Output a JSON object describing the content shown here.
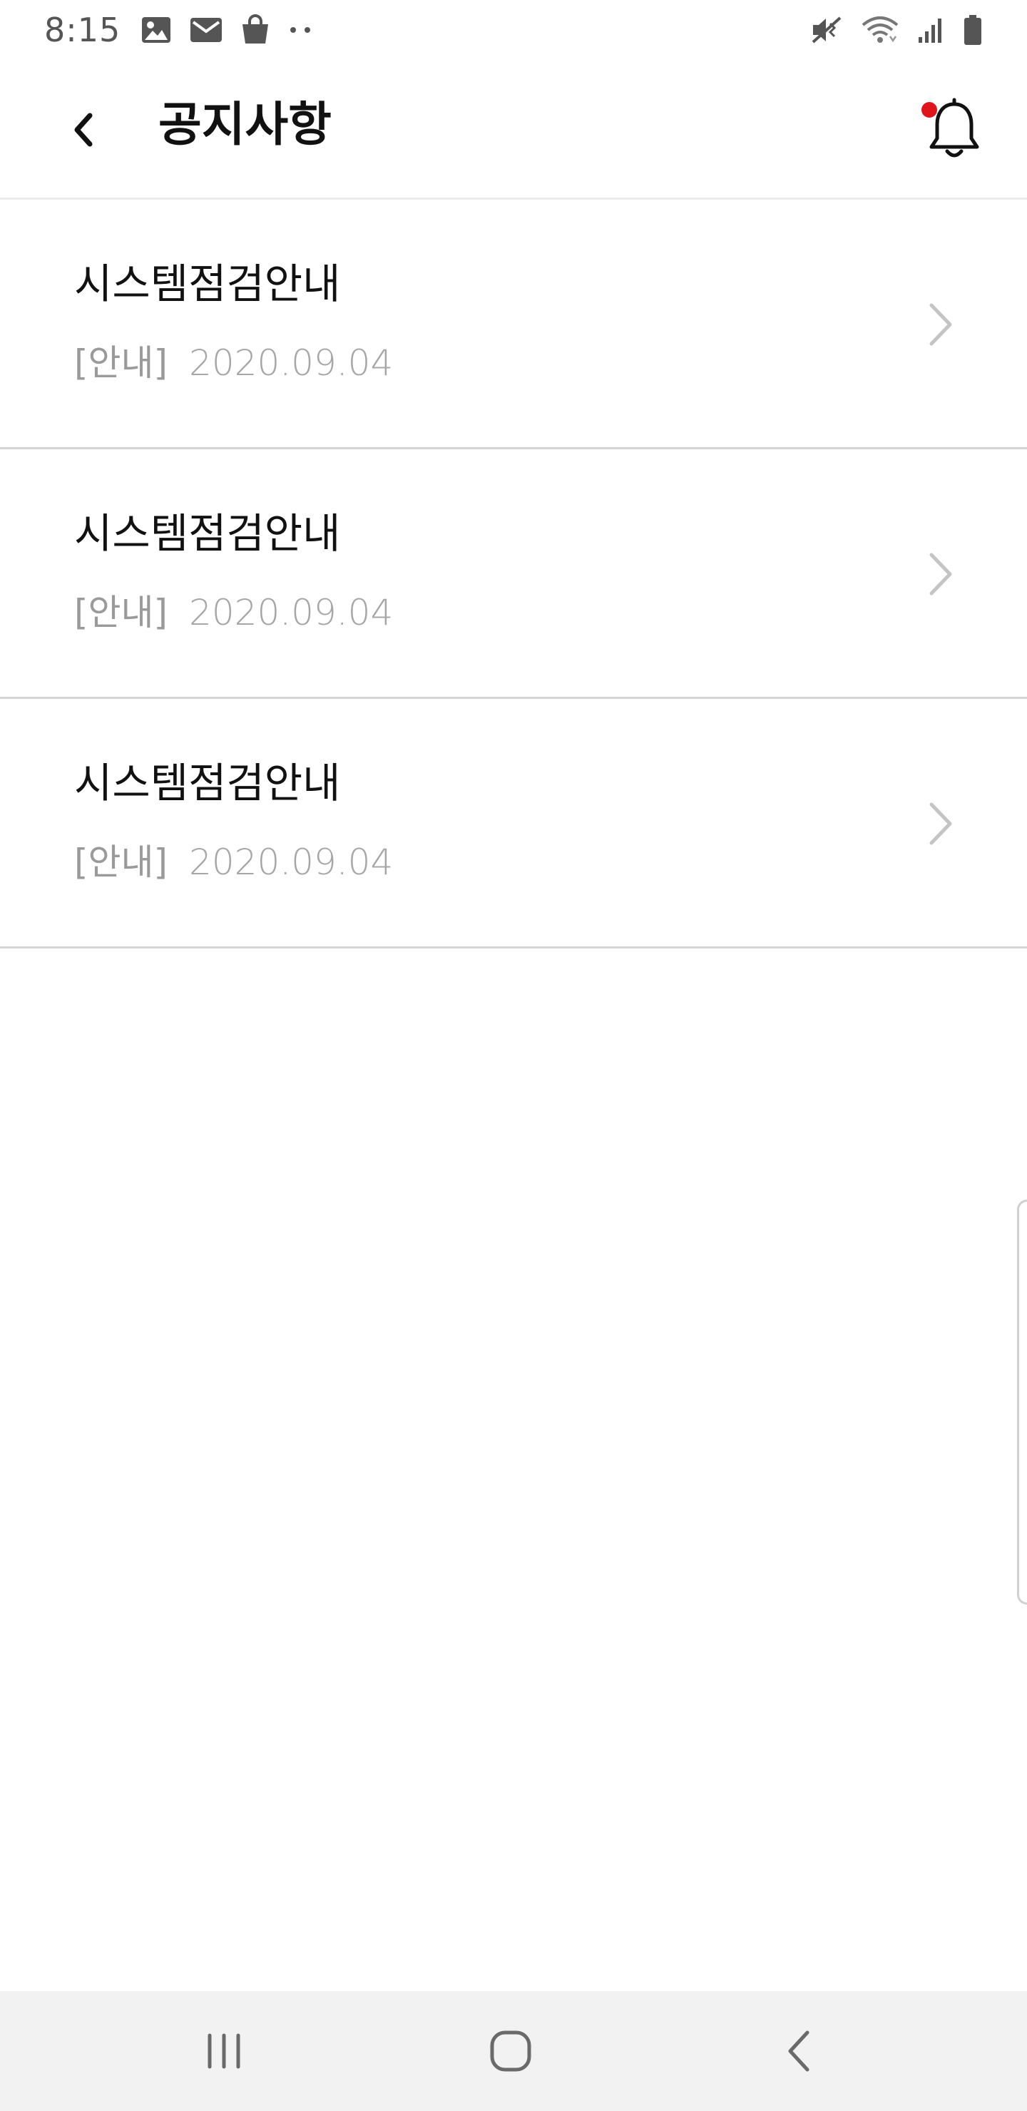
{
  "status_bar": {
    "time": "8:15",
    "left_icons": [
      "image-icon",
      "mail-icon",
      "shopping-bag-icon",
      "more-dots-icon"
    ],
    "right_icons": [
      "vibrate-mute-icon",
      "wifi-icon",
      "signal-icon",
      "battery-icon"
    ]
  },
  "header": {
    "title": "공지사항",
    "back_icon": "chevron-left-icon",
    "bell_icon": "bell-icon",
    "has_notification": true
  },
  "notices": [
    {
      "title": "시스템점검안내",
      "category": "[안내]",
      "date": "2020.09.04"
    },
    {
      "title": "시스템점검안내",
      "category": "[안내]",
      "date": "2020.09.04"
    },
    {
      "title": "시스템점검안내",
      "category": "[안내]",
      "date": "2020.09.04"
    }
  ],
  "nav_bar": {
    "recent_icon": "recent-apps-icon",
    "home_icon": "home-icon",
    "back_icon": "back-icon"
  },
  "colors": {
    "notification_dot": "#e0141b",
    "divider": "#d4d4d4",
    "meta_text": "#a6a6a6",
    "nav_background": "#f2f2f2"
  }
}
